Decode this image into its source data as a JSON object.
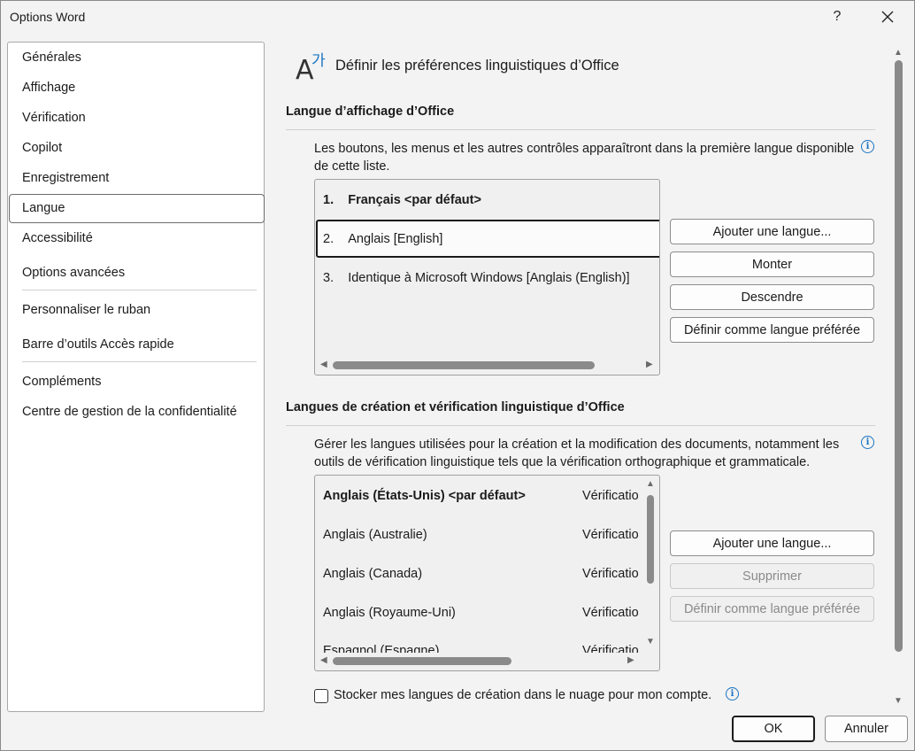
{
  "window": {
    "title": "Options Word",
    "help_label": "?",
    "close_label": "✕"
  },
  "nav": {
    "items": [
      {
        "label": "Générales"
      },
      {
        "label": "Affichage"
      },
      {
        "label": "Vérification"
      },
      {
        "label": "Copilot"
      },
      {
        "label": "Enregistrement"
      },
      {
        "label": "Langue",
        "selected": true
      },
      {
        "label": "Accessibilité"
      },
      {
        "label": "Options avancées"
      },
      {
        "label": "Personnaliser le ruban"
      },
      {
        "label": "Barre d’outils Accès rapide"
      },
      {
        "label": "Compléments"
      },
      {
        "label": "Centre de gestion de la confidentialité"
      }
    ]
  },
  "header": {
    "title": "Définir les préférences linguistiques d’Office",
    "icon": "language-icon",
    "icon_glyph_a": "A",
    "icon_glyph_b": "가"
  },
  "display_section": {
    "title": "Langue d’affichage d’Office",
    "description": "Les boutons, les menus et les autres contrôles apparaîtront dans la première langue disponible de cette liste.",
    "languages": [
      {
        "num": "1.",
        "name": "Français <par défaut>",
        "bold": true
      },
      {
        "num": "2.",
        "name": "Anglais [English]",
        "selected": true
      },
      {
        "num": "3.",
        "name": "Identique à Microsoft Windows [Anglais (English)]"
      }
    ],
    "buttons": {
      "add": "Ajouter une langue...",
      "up": "Monter",
      "down": "Descendre",
      "preferred": "Définir comme langue préférée"
    }
  },
  "authoring_section": {
    "title": "Langues de création et vérification linguistique d’Office",
    "description": "Gérer les langues utilisées pour la création et la modification des documents, notamment les outils de vérification linguistique tels que la vérification orthographique et grammaticale.",
    "languages": [
      {
        "name": "Anglais (États-Unis) <par défaut>",
        "status": "Vérificatio",
        "bold": true
      },
      {
        "name": "Anglais (Australie)",
        "status": "Vérificatio"
      },
      {
        "name": "Anglais (Canada)",
        "status": "Vérificatio"
      },
      {
        "name": "Anglais (Royaume-Uni)",
        "status": "Vérificatio"
      },
      {
        "name": "Espagnol (Espagne)",
        "status": "Vérificatio"
      }
    ],
    "buttons": {
      "add": "Ajouter une langue...",
      "remove": "Supprimer",
      "preferred": "Définir comme langue préférée"
    },
    "cloud_checkbox": {
      "label": "Stocker mes langues de création dans le nuage pour mon compte.",
      "checked": false
    }
  },
  "footer": {
    "ok": "OK",
    "cancel": "Annuler"
  },
  "colors": {
    "accent": "#1a73c2",
    "background": "#f3f3f3"
  }
}
